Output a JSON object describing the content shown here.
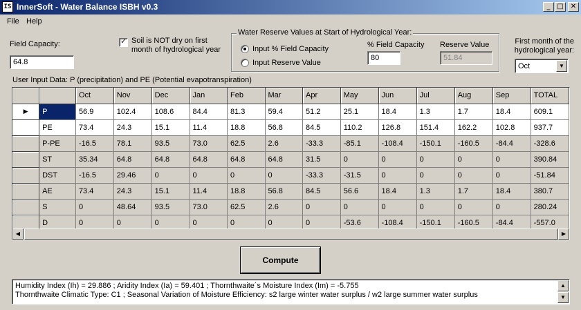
{
  "window": {
    "icon_text": "IS",
    "title": "InnerSoft - Water Balance ISBH v0.3",
    "minimize": "_",
    "maximize": "□",
    "close": "✕"
  },
  "menu": {
    "file": "File",
    "help": "Help"
  },
  "field_capacity": {
    "label": "Field Capacity:",
    "value": "64.8"
  },
  "soil_checkbox": {
    "checked_mark": "✓",
    "label_line1": "Soil is NOT dry on first",
    "label_line2": "month of hydrological year"
  },
  "reserve_group": {
    "title": "Water Reserve Values at Start of Hydrological Year:",
    "radio_pct": "Input % Field Capacity",
    "radio_reserve": "Input Reserve Value",
    "pct_label": "% Field Capacity",
    "pct_value": "80",
    "reserve_label": "Reserve Value",
    "reserve_value": "51.84"
  },
  "first_month": {
    "label_line1": "First month of the",
    "label_line2": "hydrological year:",
    "value": "Oct",
    "arrow": "▼"
  },
  "grid_caption": "User Input Data: P (precipitation) and PE (Potential evapotranspiration)",
  "grid": {
    "row_pointer": "▶",
    "headers": [
      "Oct",
      "Nov",
      "Dec",
      "Jan",
      "Feb",
      "Mar",
      "Apr",
      "May",
      "Jun",
      "Jul",
      "Aug",
      "Sep",
      "TOTAL"
    ],
    "rows": [
      {
        "label": "P",
        "cells": [
          "56.9",
          "102.4",
          "108.6",
          "84.4",
          "81.3",
          "59.4",
          "51.2",
          "25.1",
          "18.4",
          "1.3",
          "1.7",
          "18.4",
          "609.1"
        ]
      },
      {
        "label": "PE",
        "cells": [
          "73.4",
          "24.3",
          "15.1",
          "11.4",
          "18.8",
          "56.8",
          "84.5",
          "110.2",
          "126.8",
          "151.4",
          "162.2",
          "102.8",
          "937.7"
        ]
      },
      {
        "label": "P-PE",
        "cells": [
          "-16.5",
          "78.1",
          "93.5",
          "73.0",
          "62.5",
          "2.6",
          "-33.3",
          "-85.1",
          "-108.4",
          "-150.1",
          "-160.5",
          "-84.4",
          "-328.6"
        ]
      },
      {
        "label": "ST",
        "cells": [
          "35.34",
          "64.8",
          "64.8",
          "64.8",
          "64.8",
          "64.8",
          "31.5",
          "0",
          "0",
          "0",
          "0",
          "0",
          "390.84"
        ]
      },
      {
        "label": "DST",
        "cells": [
          "-16.5",
          "29.46",
          "0",
          "0",
          "0",
          "0",
          "-33.3",
          "-31.5",
          "0",
          "0",
          "0",
          "0",
          "-51.84"
        ]
      },
      {
        "label": "AE",
        "cells": [
          "73.4",
          "24.3",
          "15.1",
          "11.4",
          "18.8",
          "56.8",
          "84.5",
          "56.6",
          "18.4",
          "1.3",
          "1.7",
          "18.4",
          "380.7"
        ]
      },
      {
        "label": "S",
        "cells": [
          "0",
          "48.64",
          "93.5",
          "73.0",
          "62.5",
          "2.6",
          "0",
          "0",
          "0",
          "0",
          "0",
          "0",
          "280.24"
        ]
      },
      {
        "label": "D",
        "cells": [
          "0",
          "0",
          "0",
          "0",
          "0",
          "0",
          "0",
          "-53.6",
          "-108.4",
          "-150.1",
          "-160.5",
          "-84.4",
          "-557.0"
        ]
      }
    ]
  },
  "compute_button": "Compute",
  "output": {
    "line1": "Humidity Index (Ih) = 29.886 ; Aridity Index (Ia) = 59.401 ; Thornthwaite´s Moisture Index (Im) = -5.755",
    "line2": "Thornthwaite Climatic Type: C1 ; Seasonal Variation of Moisture Efficiency: s2 large winter water surplus / w2 large summer water surplus"
  },
  "scroll": {
    "left": "◀",
    "right": "▶",
    "up": "▲",
    "down": "▼"
  }
}
